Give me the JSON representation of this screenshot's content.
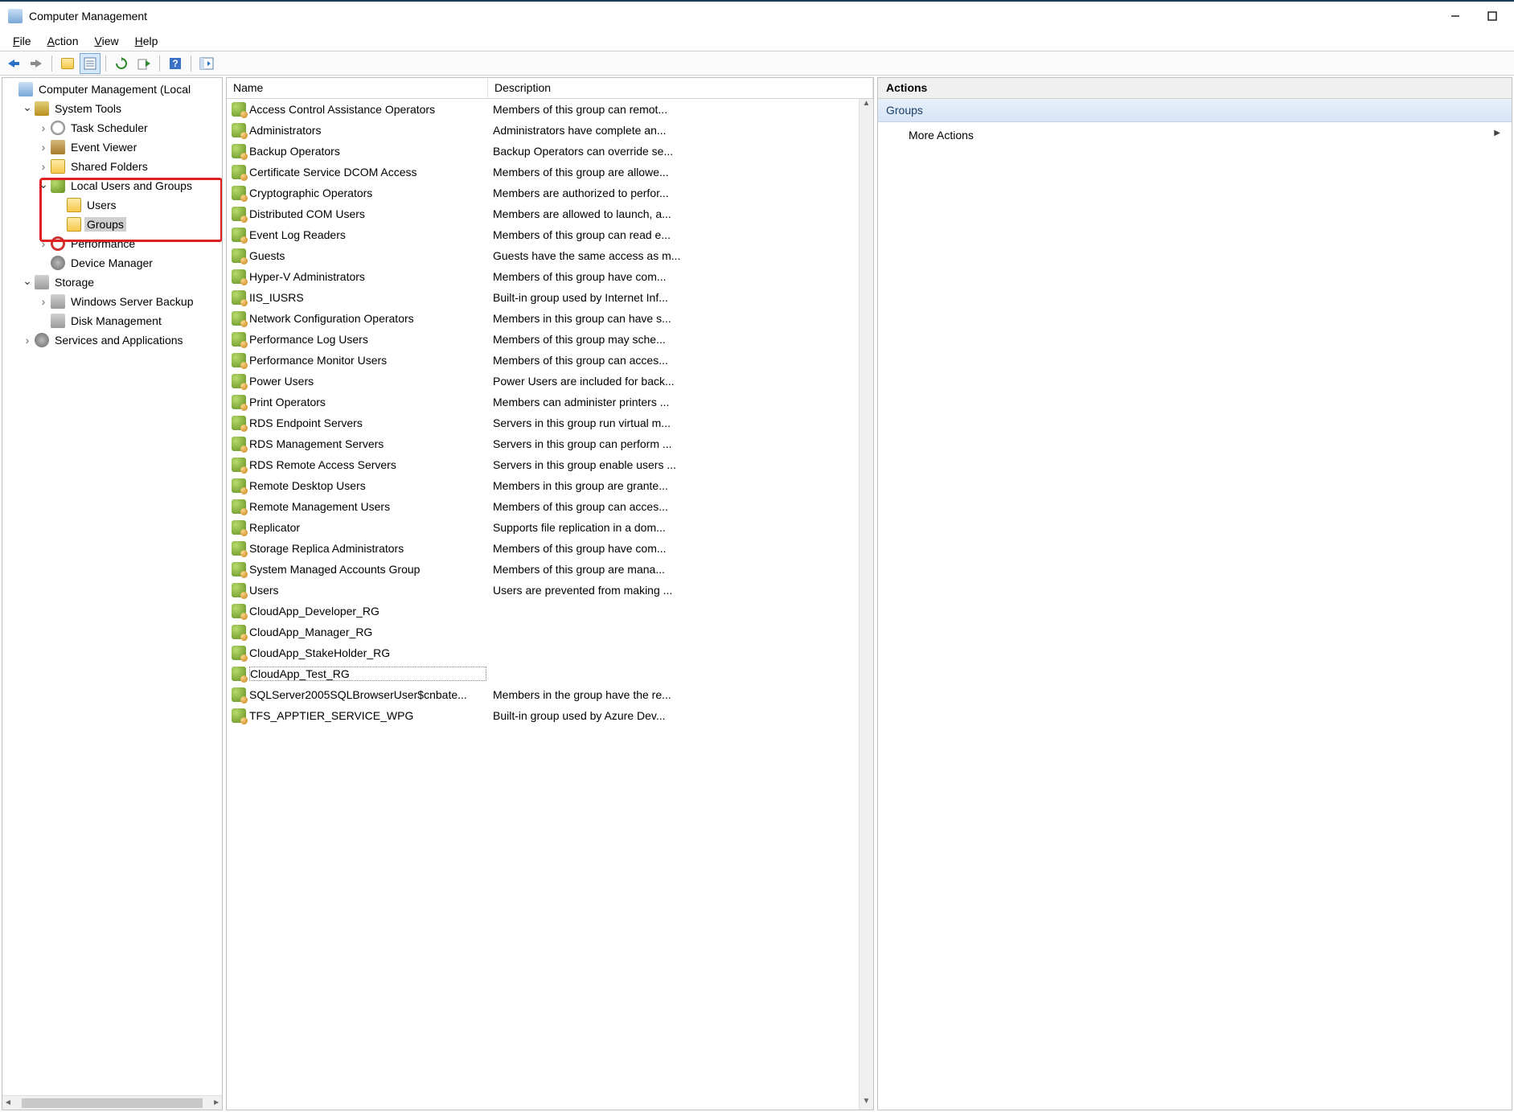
{
  "window": {
    "title": "Computer Management"
  },
  "menu": {
    "file": "File",
    "action": "Action",
    "view": "View",
    "help": "Help"
  },
  "toolbar_icons": [
    "back",
    "forward",
    "sep",
    "up-folder",
    "props",
    "sep",
    "refresh",
    "export",
    "sep",
    "help",
    "sep",
    "show-hide"
  ],
  "tree": [
    {
      "indent": 0,
      "exp": "",
      "icon": "server",
      "label": "Computer Management (Local"
    },
    {
      "indent": 1,
      "exp": "v",
      "icon": "tools",
      "label": "System Tools"
    },
    {
      "indent": 2,
      "exp": ">",
      "icon": "clock",
      "label": "Task Scheduler"
    },
    {
      "indent": 2,
      "exp": ">",
      "icon": "book",
      "label": "Event Viewer"
    },
    {
      "indent": 2,
      "exp": ">",
      "icon": "folder",
      "label": "Shared Folders"
    },
    {
      "indent": 2,
      "exp": "v",
      "icon": "people",
      "label": "Local Users and Groups"
    },
    {
      "indent": 3,
      "exp": "",
      "icon": "folder",
      "label": "Users"
    },
    {
      "indent": 3,
      "exp": "",
      "icon": "folder",
      "label": "Groups",
      "selected": true
    },
    {
      "indent": 2,
      "exp": ">",
      "icon": "no",
      "label": "Performance"
    },
    {
      "indent": 2,
      "exp": "",
      "icon": "gear",
      "label": "Device Manager"
    },
    {
      "indent": 1,
      "exp": "v",
      "icon": "disk",
      "label": "Storage"
    },
    {
      "indent": 2,
      "exp": ">",
      "icon": "disk",
      "label": "Windows Server Backup"
    },
    {
      "indent": 2,
      "exp": "",
      "icon": "disk",
      "label": "Disk Management"
    },
    {
      "indent": 1,
      "exp": ">",
      "icon": "gear",
      "label": "Services and Applications"
    }
  ],
  "list": {
    "columns": {
      "name": "Name",
      "desc": "Description"
    },
    "rows": [
      {
        "name": "Access Control Assistance Operators",
        "desc": "Members of this group can remot..."
      },
      {
        "name": "Administrators",
        "desc": "Administrators have complete an..."
      },
      {
        "name": "Backup Operators",
        "desc": "Backup Operators can override se..."
      },
      {
        "name": "Certificate Service DCOM Access",
        "desc": "Members of this group are allowe..."
      },
      {
        "name": "Cryptographic Operators",
        "desc": "Members are authorized to perfor..."
      },
      {
        "name": "Distributed COM Users",
        "desc": "Members are allowed to launch, a..."
      },
      {
        "name": "Event Log Readers",
        "desc": "Members of this group can read e..."
      },
      {
        "name": "Guests",
        "desc": "Guests have the same access as m..."
      },
      {
        "name": "Hyper-V Administrators",
        "desc": "Members of this group have com..."
      },
      {
        "name": "IIS_IUSRS",
        "desc": "Built-in group used by Internet Inf..."
      },
      {
        "name": "Network Configuration Operators",
        "desc": "Members in this group can have s..."
      },
      {
        "name": "Performance Log Users",
        "desc": "Members of this group may sche..."
      },
      {
        "name": "Performance Monitor Users",
        "desc": "Members of this group can acces..."
      },
      {
        "name": "Power Users",
        "desc": "Power Users are included for back..."
      },
      {
        "name": "Print Operators",
        "desc": "Members can administer printers ..."
      },
      {
        "name": "RDS Endpoint Servers",
        "desc": "Servers in this group run virtual m..."
      },
      {
        "name": "RDS Management Servers",
        "desc": "Servers in this group can perform ..."
      },
      {
        "name": "RDS Remote Access Servers",
        "desc": "Servers in this group enable users ..."
      },
      {
        "name": "Remote Desktop Users",
        "desc": "Members in this group are grante..."
      },
      {
        "name": "Remote Management Users",
        "desc": "Members of this group can acces..."
      },
      {
        "name": "Replicator",
        "desc": "Supports file replication in a dom..."
      },
      {
        "name": "Storage Replica Administrators",
        "desc": "Members of this group have com..."
      },
      {
        "name": "System Managed Accounts Group",
        "desc": "Members of this group are mana..."
      },
      {
        "name": "Users",
        "desc": "Users are prevented from making ..."
      },
      {
        "name": "CloudApp_Developer_RG",
        "desc": ""
      },
      {
        "name": "CloudApp_Manager_RG",
        "desc": ""
      },
      {
        "name": "CloudApp_StakeHolder_RG",
        "desc": ""
      },
      {
        "name": "CloudApp_Test_RG",
        "desc": "",
        "focused": true
      },
      {
        "name": "SQLServer2005SQLBrowserUser$cnbate...",
        "desc": "Members in the group have the re..."
      },
      {
        "name": "TFS_APPTIER_SERVICE_WPG",
        "desc": "Built-in group used by Azure Dev..."
      }
    ]
  },
  "actions": {
    "header": "Actions",
    "category": "Groups",
    "more": "More Actions"
  }
}
